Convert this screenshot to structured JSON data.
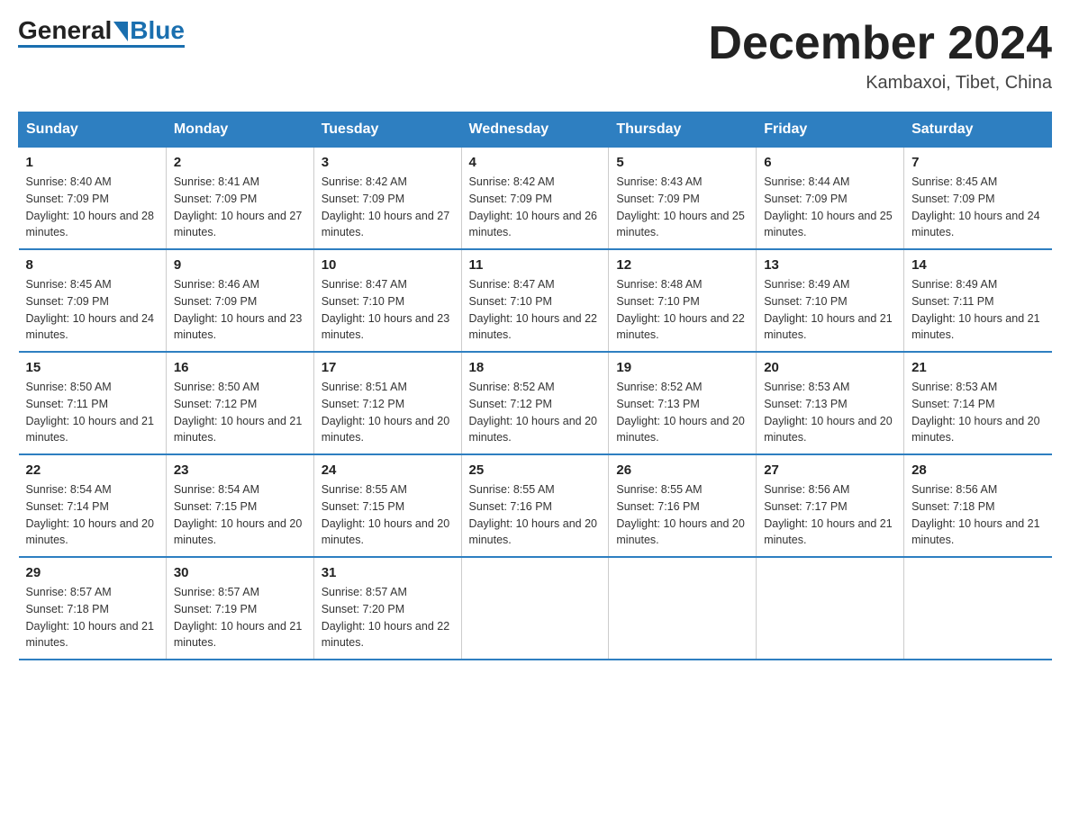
{
  "logo": {
    "general": "General",
    "blue": "Blue"
  },
  "header": {
    "month": "December 2024",
    "location": "Kambaxoi, Tibet, China"
  },
  "weekdays": [
    "Sunday",
    "Monday",
    "Tuesday",
    "Wednesday",
    "Thursday",
    "Friday",
    "Saturday"
  ],
  "weeks": [
    [
      {
        "day": "1",
        "sunrise": "8:40 AM",
        "sunset": "7:09 PM",
        "daylight": "10 hours and 28 minutes."
      },
      {
        "day": "2",
        "sunrise": "8:41 AM",
        "sunset": "7:09 PM",
        "daylight": "10 hours and 27 minutes."
      },
      {
        "day": "3",
        "sunrise": "8:42 AM",
        "sunset": "7:09 PM",
        "daylight": "10 hours and 27 minutes."
      },
      {
        "day": "4",
        "sunrise": "8:42 AM",
        "sunset": "7:09 PM",
        "daylight": "10 hours and 26 minutes."
      },
      {
        "day": "5",
        "sunrise": "8:43 AM",
        "sunset": "7:09 PM",
        "daylight": "10 hours and 25 minutes."
      },
      {
        "day": "6",
        "sunrise": "8:44 AM",
        "sunset": "7:09 PM",
        "daylight": "10 hours and 25 minutes."
      },
      {
        "day": "7",
        "sunrise": "8:45 AM",
        "sunset": "7:09 PM",
        "daylight": "10 hours and 24 minutes."
      }
    ],
    [
      {
        "day": "8",
        "sunrise": "8:45 AM",
        "sunset": "7:09 PM",
        "daylight": "10 hours and 24 minutes."
      },
      {
        "day": "9",
        "sunrise": "8:46 AM",
        "sunset": "7:09 PM",
        "daylight": "10 hours and 23 minutes."
      },
      {
        "day": "10",
        "sunrise": "8:47 AM",
        "sunset": "7:10 PM",
        "daylight": "10 hours and 23 minutes."
      },
      {
        "day": "11",
        "sunrise": "8:47 AM",
        "sunset": "7:10 PM",
        "daylight": "10 hours and 22 minutes."
      },
      {
        "day": "12",
        "sunrise": "8:48 AM",
        "sunset": "7:10 PM",
        "daylight": "10 hours and 22 minutes."
      },
      {
        "day": "13",
        "sunrise": "8:49 AM",
        "sunset": "7:10 PM",
        "daylight": "10 hours and 21 minutes."
      },
      {
        "day": "14",
        "sunrise": "8:49 AM",
        "sunset": "7:11 PM",
        "daylight": "10 hours and 21 minutes."
      }
    ],
    [
      {
        "day": "15",
        "sunrise": "8:50 AM",
        "sunset": "7:11 PM",
        "daylight": "10 hours and 21 minutes."
      },
      {
        "day": "16",
        "sunrise": "8:50 AM",
        "sunset": "7:12 PM",
        "daylight": "10 hours and 21 minutes."
      },
      {
        "day": "17",
        "sunrise": "8:51 AM",
        "sunset": "7:12 PM",
        "daylight": "10 hours and 20 minutes."
      },
      {
        "day": "18",
        "sunrise": "8:52 AM",
        "sunset": "7:12 PM",
        "daylight": "10 hours and 20 minutes."
      },
      {
        "day": "19",
        "sunrise": "8:52 AM",
        "sunset": "7:13 PM",
        "daylight": "10 hours and 20 minutes."
      },
      {
        "day": "20",
        "sunrise": "8:53 AM",
        "sunset": "7:13 PM",
        "daylight": "10 hours and 20 minutes."
      },
      {
        "day": "21",
        "sunrise": "8:53 AM",
        "sunset": "7:14 PM",
        "daylight": "10 hours and 20 minutes."
      }
    ],
    [
      {
        "day": "22",
        "sunrise": "8:54 AM",
        "sunset": "7:14 PM",
        "daylight": "10 hours and 20 minutes."
      },
      {
        "day": "23",
        "sunrise": "8:54 AM",
        "sunset": "7:15 PM",
        "daylight": "10 hours and 20 minutes."
      },
      {
        "day": "24",
        "sunrise": "8:55 AM",
        "sunset": "7:15 PM",
        "daylight": "10 hours and 20 minutes."
      },
      {
        "day": "25",
        "sunrise": "8:55 AM",
        "sunset": "7:16 PM",
        "daylight": "10 hours and 20 minutes."
      },
      {
        "day": "26",
        "sunrise": "8:55 AM",
        "sunset": "7:16 PM",
        "daylight": "10 hours and 20 minutes."
      },
      {
        "day": "27",
        "sunrise": "8:56 AM",
        "sunset": "7:17 PM",
        "daylight": "10 hours and 21 minutes."
      },
      {
        "day": "28",
        "sunrise": "8:56 AM",
        "sunset": "7:18 PM",
        "daylight": "10 hours and 21 minutes."
      }
    ],
    [
      {
        "day": "29",
        "sunrise": "8:57 AM",
        "sunset": "7:18 PM",
        "daylight": "10 hours and 21 minutes."
      },
      {
        "day": "30",
        "sunrise": "8:57 AM",
        "sunset": "7:19 PM",
        "daylight": "10 hours and 21 minutes."
      },
      {
        "day": "31",
        "sunrise": "8:57 AM",
        "sunset": "7:20 PM",
        "daylight": "10 hours and 22 minutes."
      },
      null,
      null,
      null,
      null
    ]
  ]
}
